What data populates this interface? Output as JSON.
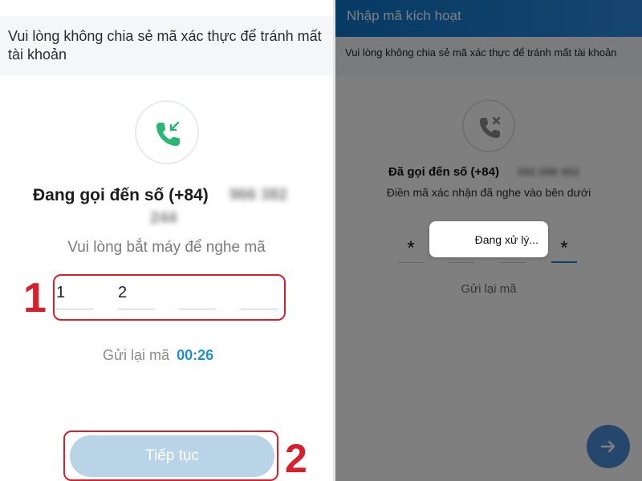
{
  "left": {
    "warning_text": "Vui lòng không chia sẻ mã xác thực để tránh mất tài khoản",
    "call_icon": "incoming-call-icon",
    "calling_prefix": "Đang gọi đến số (+84)",
    "phone_part_1": "966 382",
    "phone_part_2": "244",
    "instruction": "Vui lòng bắt máy để nghe mã",
    "otp_digits": [
      "1",
      "2",
      "",
      ""
    ],
    "resend_label": "Gửi lại mã",
    "resend_timer": "00:26",
    "continue_label": "Tiếp tục",
    "step_1_label": "1",
    "step_2_label": "2"
  },
  "right": {
    "header_title": "Nhập mã kích hoạt",
    "warning_text": "Vui lòng không chia sẻ mã xác thực để tránh mất tài khoản",
    "call_icon": "missed-call-icon",
    "calling_prefix": "Đã gọi đến số (+84)",
    "phone_number": "392 098 452",
    "instruction": "Điền mã xác nhận đã nghe vào bên dưới",
    "otp_digits": [
      "*",
      "",
      "",
      "*"
    ],
    "processing_text": "Đang xử lý...",
    "resend_label": "Gửi lại mã",
    "fab_icon": "arrow-right-icon"
  },
  "colors": {
    "accent_blue": "#1f8fd6",
    "header_blue": "#0d76c9",
    "highlight_red": "#d9202a",
    "call_green": "#2bb673",
    "button_disabled": "#b9d3e7"
  }
}
